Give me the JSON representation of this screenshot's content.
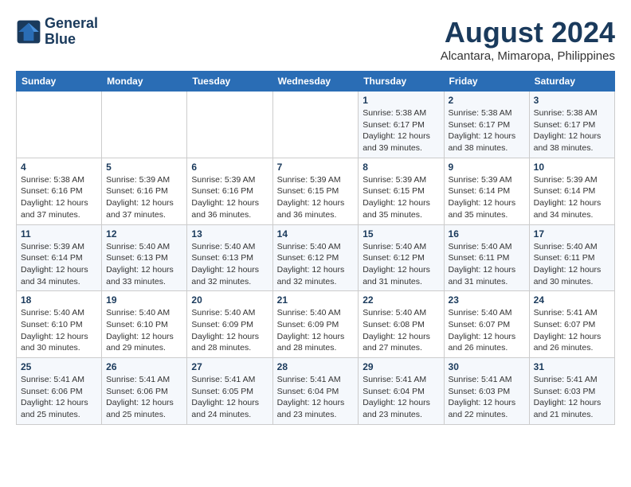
{
  "header": {
    "logo_line1": "General",
    "logo_line2": "Blue",
    "title": "August 2024",
    "subtitle": "Alcantara, Mimaropa, Philippines"
  },
  "weekdays": [
    "Sunday",
    "Monday",
    "Tuesday",
    "Wednesday",
    "Thursday",
    "Friday",
    "Saturday"
  ],
  "weeks": [
    [
      {
        "num": "",
        "info": ""
      },
      {
        "num": "",
        "info": ""
      },
      {
        "num": "",
        "info": ""
      },
      {
        "num": "",
        "info": ""
      },
      {
        "num": "1",
        "info": "Sunrise: 5:38 AM\nSunset: 6:17 PM\nDaylight: 12 hours\nand 39 minutes."
      },
      {
        "num": "2",
        "info": "Sunrise: 5:38 AM\nSunset: 6:17 PM\nDaylight: 12 hours\nand 38 minutes."
      },
      {
        "num": "3",
        "info": "Sunrise: 5:38 AM\nSunset: 6:17 PM\nDaylight: 12 hours\nand 38 minutes."
      }
    ],
    [
      {
        "num": "4",
        "info": "Sunrise: 5:38 AM\nSunset: 6:16 PM\nDaylight: 12 hours\nand 37 minutes."
      },
      {
        "num": "5",
        "info": "Sunrise: 5:39 AM\nSunset: 6:16 PM\nDaylight: 12 hours\nand 37 minutes."
      },
      {
        "num": "6",
        "info": "Sunrise: 5:39 AM\nSunset: 6:16 PM\nDaylight: 12 hours\nand 36 minutes."
      },
      {
        "num": "7",
        "info": "Sunrise: 5:39 AM\nSunset: 6:15 PM\nDaylight: 12 hours\nand 36 minutes."
      },
      {
        "num": "8",
        "info": "Sunrise: 5:39 AM\nSunset: 6:15 PM\nDaylight: 12 hours\nand 35 minutes."
      },
      {
        "num": "9",
        "info": "Sunrise: 5:39 AM\nSunset: 6:14 PM\nDaylight: 12 hours\nand 35 minutes."
      },
      {
        "num": "10",
        "info": "Sunrise: 5:39 AM\nSunset: 6:14 PM\nDaylight: 12 hours\nand 34 minutes."
      }
    ],
    [
      {
        "num": "11",
        "info": "Sunrise: 5:39 AM\nSunset: 6:14 PM\nDaylight: 12 hours\nand 34 minutes."
      },
      {
        "num": "12",
        "info": "Sunrise: 5:40 AM\nSunset: 6:13 PM\nDaylight: 12 hours\nand 33 minutes."
      },
      {
        "num": "13",
        "info": "Sunrise: 5:40 AM\nSunset: 6:13 PM\nDaylight: 12 hours\nand 32 minutes."
      },
      {
        "num": "14",
        "info": "Sunrise: 5:40 AM\nSunset: 6:12 PM\nDaylight: 12 hours\nand 32 minutes."
      },
      {
        "num": "15",
        "info": "Sunrise: 5:40 AM\nSunset: 6:12 PM\nDaylight: 12 hours\nand 31 minutes."
      },
      {
        "num": "16",
        "info": "Sunrise: 5:40 AM\nSunset: 6:11 PM\nDaylight: 12 hours\nand 31 minutes."
      },
      {
        "num": "17",
        "info": "Sunrise: 5:40 AM\nSunset: 6:11 PM\nDaylight: 12 hours\nand 30 minutes."
      }
    ],
    [
      {
        "num": "18",
        "info": "Sunrise: 5:40 AM\nSunset: 6:10 PM\nDaylight: 12 hours\nand 30 minutes."
      },
      {
        "num": "19",
        "info": "Sunrise: 5:40 AM\nSunset: 6:10 PM\nDaylight: 12 hours\nand 29 minutes."
      },
      {
        "num": "20",
        "info": "Sunrise: 5:40 AM\nSunset: 6:09 PM\nDaylight: 12 hours\nand 28 minutes."
      },
      {
        "num": "21",
        "info": "Sunrise: 5:40 AM\nSunset: 6:09 PM\nDaylight: 12 hours\nand 28 minutes."
      },
      {
        "num": "22",
        "info": "Sunrise: 5:40 AM\nSunset: 6:08 PM\nDaylight: 12 hours\nand 27 minutes."
      },
      {
        "num": "23",
        "info": "Sunrise: 5:40 AM\nSunset: 6:07 PM\nDaylight: 12 hours\nand 26 minutes."
      },
      {
        "num": "24",
        "info": "Sunrise: 5:41 AM\nSunset: 6:07 PM\nDaylight: 12 hours\nand 26 minutes."
      }
    ],
    [
      {
        "num": "25",
        "info": "Sunrise: 5:41 AM\nSunset: 6:06 PM\nDaylight: 12 hours\nand 25 minutes."
      },
      {
        "num": "26",
        "info": "Sunrise: 5:41 AM\nSunset: 6:06 PM\nDaylight: 12 hours\nand 25 minutes."
      },
      {
        "num": "27",
        "info": "Sunrise: 5:41 AM\nSunset: 6:05 PM\nDaylight: 12 hours\nand 24 minutes."
      },
      {
        "num": "28",
        "info": "Sunrise: 5:41 AM\nSunset: 6:04 PM\nDaylight: 12 hours\nand 23 minutes."
      },
      {
        "num": "29",
        "info": "Sunrise: 5:41 AM\nSunset: 6:04 PM\nDaylight: 12 hours\nand 23 minutes."
      },
      {
        "num": "30",
        "info": "Sunrise: 5:41 AM\nSunset: 6:03 PM\nDaylight: 12 hours\nand 22 minutes."
      },
      {
        "num": "31",
        "info": "Sunrise: 5:41 AM\nSunset: 6:03 PM\nDaylight: 12 hours\nand 21 minutes."
      }
    ]
  ]
}
